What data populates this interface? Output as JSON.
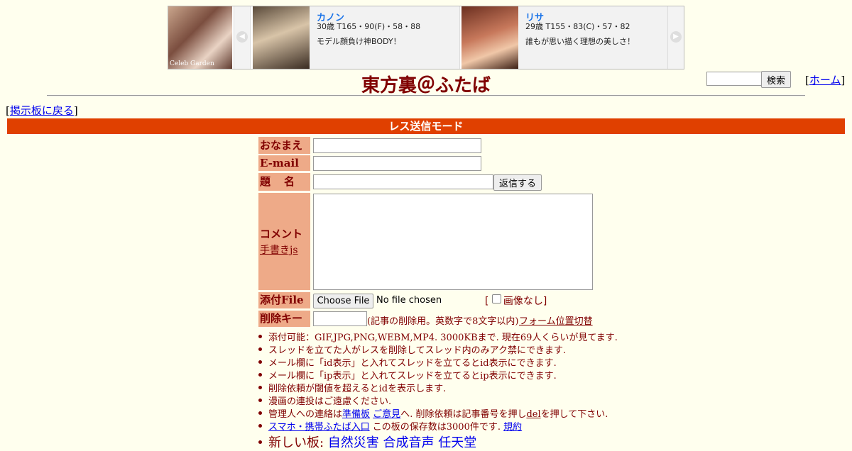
{
  "banner": {
    "logo_text": "Celeb Garden",
    "prev_arrow": "◀",
    "next_arrow": "▶",
    "cards": [
      {
        "name": "カノン",
        "stats": "30歳 T165・90(F)・58・88",
        "catch": "モデル顔負け神BODY！"
      },
      {
        "name": "リサ",
        "stats": "29歳 T155・83(C)・57・82",
        "catch": "誰もが思い描く理想の美しさ！"
      }
    ]
  },
  "header": {
    "title": "東方裏＠ふたば",
    "search_button": "検索",
    "home_bracket_open": "[",
    "home_link": "ホーム",
    "home_bracket_close": "]"
  },
  "nav": {
    "back_open": "[",
    "back_link": "掲示板に戻る",
    "back_close": "]"
  },
  "mode_bar": "レス送信モード",
  "form": {
    "name_label": "おなまえ",
    "email_label": "E-mail",
    "subject_label": "題　名",
    "submit_button": "返信する",
    "comment_label": "コメント",
    "handwrite_link": "手書きjs",
    "file_label": "添付File",
    "file_button": "Choose File",
    "file_status": "No file chosen",
    "noimage_open": "[",
    "noimage_label": "画像なし",
    "noimage_close": "]",
    "delkey_label": "削除キー",
    "delkey_note": "(記事の削除用。英数字で8文字以内)",
    "form_pos_link": "フォーム位置切替"
  },
  "notes": {
    "n1": "添付可能：GIF,JPG,PNG,WEBM,MP4. 3000KBまで. 現在69人くらいが見てます.",
    "n2": "スレッドを立てた人がレスを削除してスレッド内のみアク禁にできます.",
    "n3": "メール欄に「id表示」と入れてスレッドを立てるとid表示にできます.",
    "n4": "メール欄に「ip表示」と入れてスレッドを立てるとip表示にできます.",
    "n5": "削除依頼が閾値を超えるとidを表示します.",
    "n6": "漫画の連投はご遠慮ください.",
    "n7_pre": "管理人への連絡は",
    "n7_link1": "準備板",
    "n7_link2": "ご意見",
    "n7_mid": "へ. 削除依頼は記事番号を押し",
    "n7_del": "del",
    "n7_post": "を押して下さい.",
    "n8_link": "スマホ・携帯ふたば入口",
    "n8_mid": " この板の保存数は3000件です. ",
    "n8_rules": "規約",
    "n9_label": "新しい板: ",
    "n9_boards": [
      "自然災害",
      "合成音声",
      "任天堂"
    ]
  }
}
